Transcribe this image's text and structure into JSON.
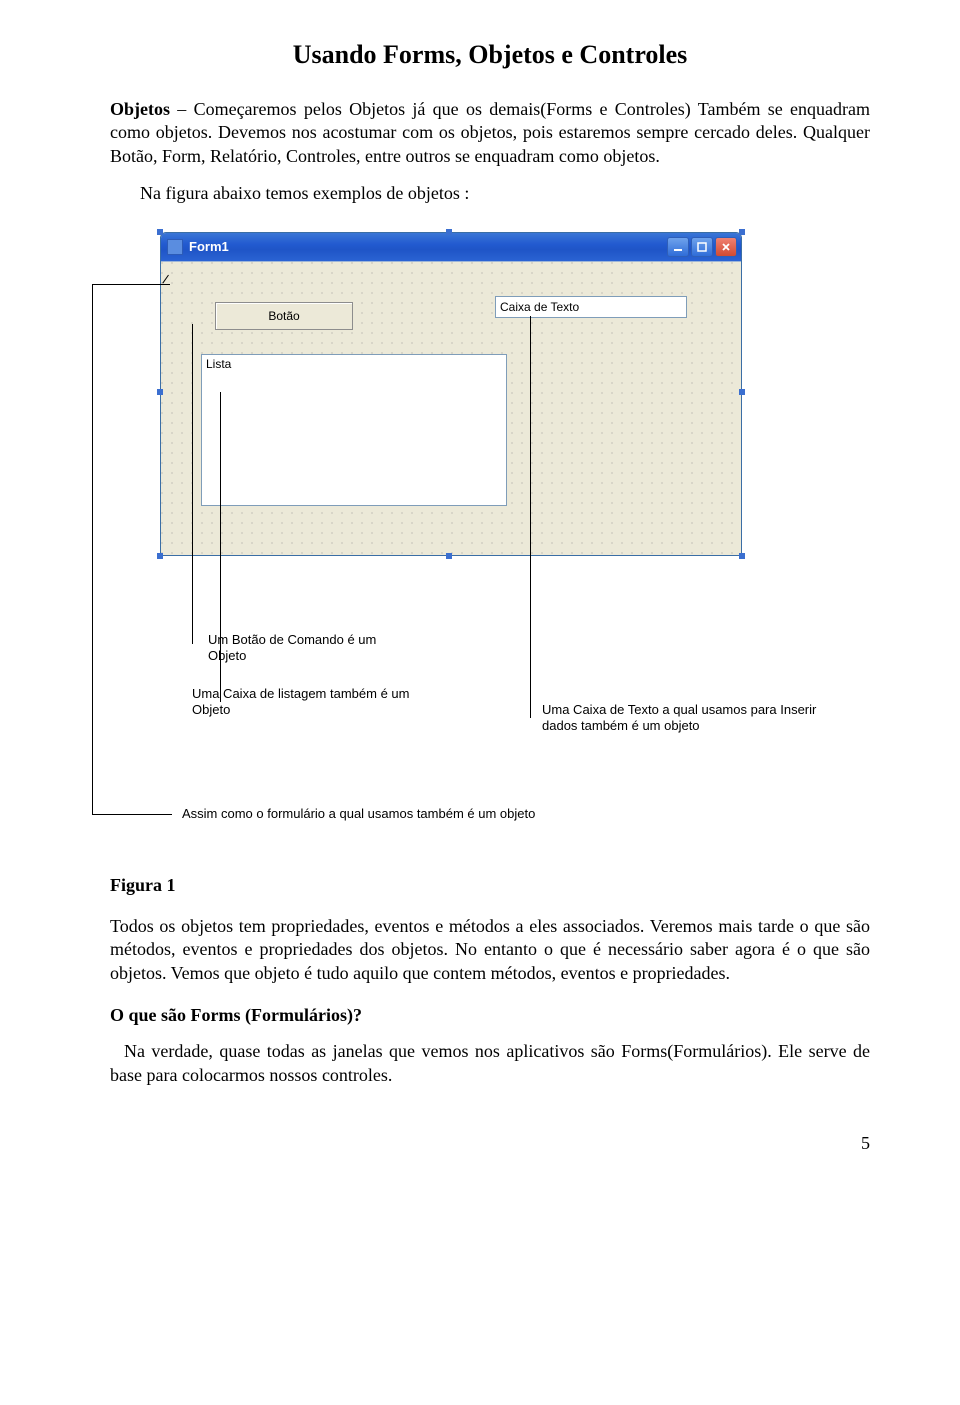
{
  "title": "Usando Forms, Objetos e Controles",
  "para1_prefix": "Objetos",
  "para1_rest": " – Começaremos pelos Objetos já que os demais(Forms e    Controles) Também se enquadram como objetos. Devemos nos acostumar com os objetos, pois estaremos sempre cercado deles. Qualquer Botão, Form, Relatório, Controles, entre outros se enquadram como objetos.",
  "para2": "Na figura abaixo temos exemplos de objetos :",
  "form": {
    "title": "Form1",
    "button_label": "Botão",
    "textbox_label": "Caixa de Texto",
    "list_label": "Lista"
  },
  "callouts": {
    "button": "Um Botão de Comando é um Objeto",
    "list": "Uma Caixa de listagem também é um Objeto",
    "textbox": "Uma Caixa de Texto a qual usamos para Inserir dados também é um objeto",
    "form": "Assim como o formulário a qual usamos também é um objeto"
  },
  "figure_label": "Figura 1",
  "para3": "Todos os objetos tem propriedades, eventos e métodos a eles associados. Veremos mais tarde o que são métodos, eventos e propriedades dos objetos. No entanto o que é necessário saber agora é o que são objetos. Vemos que objeto é tudo aquilo que contem métodos, eventos e propriedades.",
  "heading2": "O que são Forms (Formulários)?",
  "para4": "Na verdade, quase todas as janelas que vemos nos aplicativos são Forms(Formulários). Ele serve de base para colocarmos nossos controles.",
  "page_number": "5"
}
